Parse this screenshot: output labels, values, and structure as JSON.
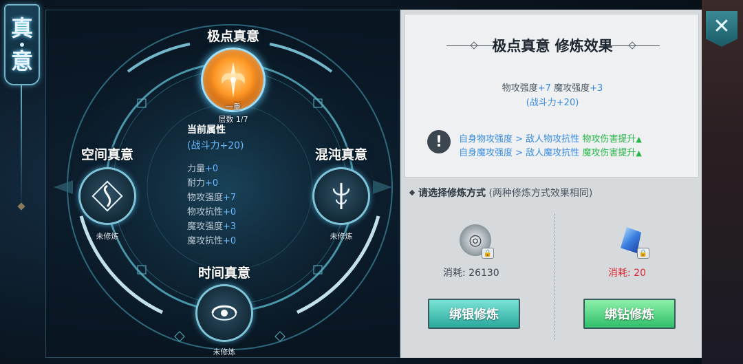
{
  "title_banner": {
    "chars": [
      "真",
      "意"
    ]
  },
  "nodes": {
    "top": {
      "name": "极点真意",
      "tier": "一重",
      "layer": "层数 1/7"
    },
    "left": {
      "name": "空间真意",
      "status": "未修炼"
    },
    "right": {
      "name": "混沌真意",
      "status": "未修炼"
    },
    "bottom": {
      "name": "时间真意",
      "status": "未修炼"
    }
  },
  "current_attributes": {
    "title": "当前属性",
    "power": "(战斗力+20)",
    "rows": [
      {
        "label": "力量",
        "value": "+0"
      },
      {
        "label": "耐力",
        "value": "+0"
      },
      {
        "label": "物攻强度",
        "value": "+7"
      },
      {
        "label": "物攻抗性",
        "value": "+0"
      },
      {
        "label": "魔攻强度",
        "value": "+3"
      },
      {
        "label": "魔攻抗性",
        "value": "+0"
      }
    ]
  },
  "effect": {
    "title": "极点真意  修炼效果",
    "line1_a": "物攻强度",
    "line1_b": "+7",
    "line1_c": "魔攻强度",
    "line1_d": "+3",
    "power": "(战斗力+20)",
    "tip1_cond": "自身物攻强度 > 敌人物攻抗性",
    "tip1_result": "物攻伤害提升",
    "tip2_cond": "自身魔攻强度 > 敌人魔攻抗性",
    "tip2_result": "魔攻伤害提升",
    "warn_glyph": "!"
  },
  "method": {
    "label": "请选择修炼方式",
    "note": "(两种修炼方式效果相同)",
    "silver": {
      "cost_label": "消耗:",
      "cost": "26130",
      "button": "绑银修炼"
    },
    "diamond": {
      "cost_label": "消耗:",
      "cost": "20",
      "button": "绑钻修炼"
    }
  },
  "close": {
    "glyph": "✕"
  },
  "colors": {
    "stat_value": "#6ab8ff",
    "up_green": "#28b64a",
    "cost_red": "#d8262e",
    "btn_silver": "#2aa99c",
    "btn_diamond": "#2fbf6a"
  }
}
